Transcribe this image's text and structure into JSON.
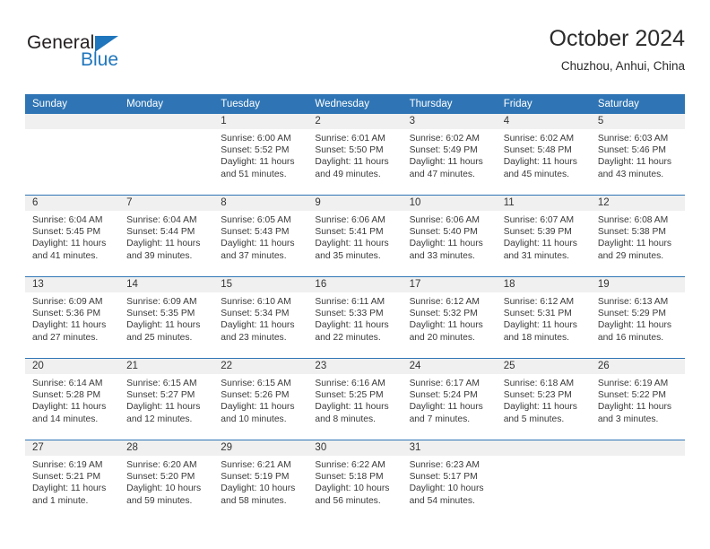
{
  "brand": {
    "name_top": "General",
    "name_bottom": "Blue",
    "color_blue": "#1f76bc"
  },
  "header": {
    "month_title": "October 2024",
    "location": "Chuzhou, Anhui, China"
  },
  "theme": {
    "header_blue": "#2f75b5",
    "daynum_bg": "#f0f0f0"
  },
  "weekdays": [
    "Sunday",
    "Monday",
    "Tuesday",
    "Wednesday",
    "Thursday",
    "Friday",
    "Saturday"
  ],
  "labels": {
    "sunrise": "Sunrise:",
    "sunset": "Sunset:",
    "daylight": "Daylight:"
  },
  "weeks": [
    [
      {
        "day": "",
        "empty": true
      },
      {
        "day": "",
        "empty": true
      },
      {
        "day": "1",
        "sunrise": "Sunrise: 6:00 AM",
        "sunset": "Sunset: 5:52 PM",
        "daylight_line1": "Daylight: 11 hours",
        "daylight_line2": "and 51 minutes."
      },
      {
        "day": "2",
        "sunrise": "Sunrise: 6:01 AM",
        "sunset": "Sunset: 5:50 PM",
        "daylight_line1": "Daylight: 11 hours",
        "daylight_line2": "and 49 minutes."
      },
      {
        "day": "3",
        "sunrise": "Sunrise: 6:02 AM",
        "sunset": "Sunset: 5:49 PM",
        "daylight_line1": "Daylight: 11 hours",
        "daylight_line2": "and 47 minutes."
      },
      {
        "day": "4",
        "sunrise": "Sunrise: 6:02 AM",
        "sunset": "Sunset: 5:48 PM",
        "daylight_line1": "Daylight: 11 hours",
        "daylight_line2": "and 45 minutes."
      },
      {
        "day": "5",
        "sunrise": "Sunrise: 6:03 AM",
        "sunset": "Sunset: 5:46 PM",
        "daylight_line1": "Daylight: 11 hours",
        "daylight_line2": "and 43 minutes."
      }
    ],
    [
      {
        "day": "6",
        "sunrise": "Sunrise: 6:04 AM",
        "sunset": "Sunset: 5:45 PM",
        "daylight_line1": "Daylight: 11 hours",
        "daylight_line2": "and 41 minutes."
      },
      {
        "day": "7",
        "sunrise": "Sunrise: 6:04 AM",
        "sunset": "Sunset: 5:44 PM",
        "daylight_line1": "Daylight: 11 hours",
        "daylight_line2": "and 39 minutes."
      },
      {
        "day": "8",
        "sunrise": "Sunrise: 6:05 AM",
        "sunset": "Sunset: 5:43 PM",
        "daylight_line1": "Daylight: 11 hours",
        "daylight_line2": "and 37 minutes."
      },
      {
        "day": "9",
        "sunrise": "Sunrise: 6:06 AM",
        "sunset": "Sunset: 5:41 PM",
        "daylight_line1": "Daylight: 11 hours",
        "daylight_line2": "and 35 minutes."
      },
      {
        "day": "10",
        "sunrise": "Sunrise: 6:06 AM",
        "sunset": "Sunset: 5:40 PM",
        "daylight_line1": "Daylight: 11 hours",
        "daylight_line2": "and 33 minutes."
      },
      {
        "day": "11",
        "sunrise": "Sunrise: 6:07 AM",
        "sunset": "Sunset: 5:39 PM",
        "daylight_line1": "Daylight: 11 hours",
        "daylight_line2": "and 31 minutes."
      },
      {
        "day": "12",
        "sunrise": "Sunrise: 6:08 AM",
        "sunset": "Sunset: 5:38 PM",
        "daylight_line1": "Daylight: 11 hours",
        "daylight_line2": "and 29 minutes."
      }
    ],
    [
      {
        "day": "13",
        "sunrise": "Sunrise: 6:09 AM",
        "sunset": "Sunset: 5:36 PM",
        "daylight_line1": "Daylight: 11 hours",
        "daylight_line2": "and 27 minutes."
      },
      {
        "day": "14",
        "sunrise": "Sunrise: 6:09 AM",
        "sunset": "Sunset: 5:35 PM",
        "daylight_line1": "Daylight: 11 hours",
        "daylight_line2": "and 25 minutes."
      },
      {
        "day": "15",
        "sunrise": "Sunrise: 6:10 AM",
        "sunset": "Sunset: 5:34 PM",
        "daylight_line1": "Daylight: 11 hours",
        "daylight_line2": "and 23 minutes."
      },
      {
        "day": "16",
        "sunrise": "Sunrise: 6:11 AM",
        "sunset": "Sunset: 5:33 PM",
        "daylight_line1": "Daylight: 11 hours",
        "daylight_line2": "and 22 minutes."
      },
      {
        "day": "17",
        "sunrise": "Sunrise: 6:12 AM",
        "sunset": "Sunset: 5:32 PM",
        "daylight_line1": "Daylight: 11 hours",
        "daylight_line2": "and 20 minutes."
      },
      {
        "day": "18",
        "sunrise": "Sunrise: 6:12 AM",
        "sunset": "Sunset: 5:31 PM",
        "daylight_line1": "Daylight: 11 hours",
        "daylight_line2": "and 18 minutes."
      },
      {
        "day": "19",
        "sunrise": "Sunrise: 6:13 AM",
        "sunset": "Sunset: 5:29 PM",
        "daylight_line1": "Daylight: 11 hours",
        "daylight_line2": "and 16 minutes."
      }
    ],
    [
      {
        "day": "20",
        "sunrise": "Sunrise: 6:14 AM",
        "sunset": "Sunset: 5:28 PM",
        "daylight_line1": "Daylight: 11 hours",
        "daylight_line2": "and 14 minutes."
      },
      {
        "day": "21",
        "sunrise": "Sunrise: 6:15 AM",
        "sunset": "Sunset: 5:27 PM",
        "daylight_line1": "Daylight: 11 hours",
        "daylight_line2": "and 12 minutes."
      },
      {
        "day": "22",
        "sunrise": "Sunrise: 6:15 AM",
        "sunset": "Sunset: 5:26 PM",
        "daylight_line1": "Daylight: 11 hours",
        "daylight_line2": "and 10 minutes."
      },
      {
        "day": "23",
        "sunrise": "Sunrise: 6:16 AM",
        "sunset": "Sunset: 5:25 PM",
        "daylight_line1": "Daylight: 11 hours",
        "daylight_line2": "and 8 minutes."
      },
      {
        "day": "24",
        "sunrise": "Sunrise: 6:17 AM",
        "sunset": "Sunset: 5:24 PM",
        "daylight_line1": "Daylight: 11 hours",
        "daylight_line2": "and 7 minutes."
      },
      {
        "day": "25",
        "sunrise": "Sunrise: 6:18 AM",
        "sunset": "Sunset: 5:23 PM",
        "daylight_line1": "Daylight: 11 hours",
        "daylight_line2": "and 5 minutes."
      },
      {
        "day": "26",
        "sunrise": "Sunrise: 6:19 AM",
        "sunset": "Sunset: 5:22 PM",
        "daylight_line1": "Daylight: 11 hours",
        "daylight_line2": "and 3 minutes."
      }
    ],
    [
      {
        "day": "27",
        "sunrise": "Sunrise: 6:19 AM",
        "sunset": "Sunset: 5:21 PM",
        "daylight_line1": "Daylight: 11 hours",
        "daylight_line2": "and 1 minute."
      },
      {
        "day": "28",
        "sunrise": "Sunrise: 6:20 AM",
        "sunset": "Sunset: 5:20 PM",
        "daylight_line1": "Daylight: 10 hours",
        "daylight_line2": "and 59 minutes."
      },
      {
        "day": "29",
        "sunrise": "Sunrise: 6:21 AM",
        "sunset": "Sunset: 5:19 PM",
        "daylight_line1": "Daylight: 10 hours",
        "daylight_line2": "and 58 minutes."
      },
      {
        "day": "30",
        "sunrise": "Sunrise: 6:22 AM",
        "sunset": "Sunset: 5:18 PM",
        "daylight_line1": "Daylight: 10 hours",
        "daylight_line2": "and 56 minutes."
      },
      {
        "day": "31",
        "sunrise": "Sunrise: 6:23 AM",
        "sunset": "Sunset: 5:17 PM",
        "daylight_line1": "Daylight: 10 hours",
        "daylight_line2": "and 54 minutes."
      },
      {
        "day": "",
        "empty": true
      },
      {
        "day": "",
        "empty": true
      }
    ]
  ]
}
